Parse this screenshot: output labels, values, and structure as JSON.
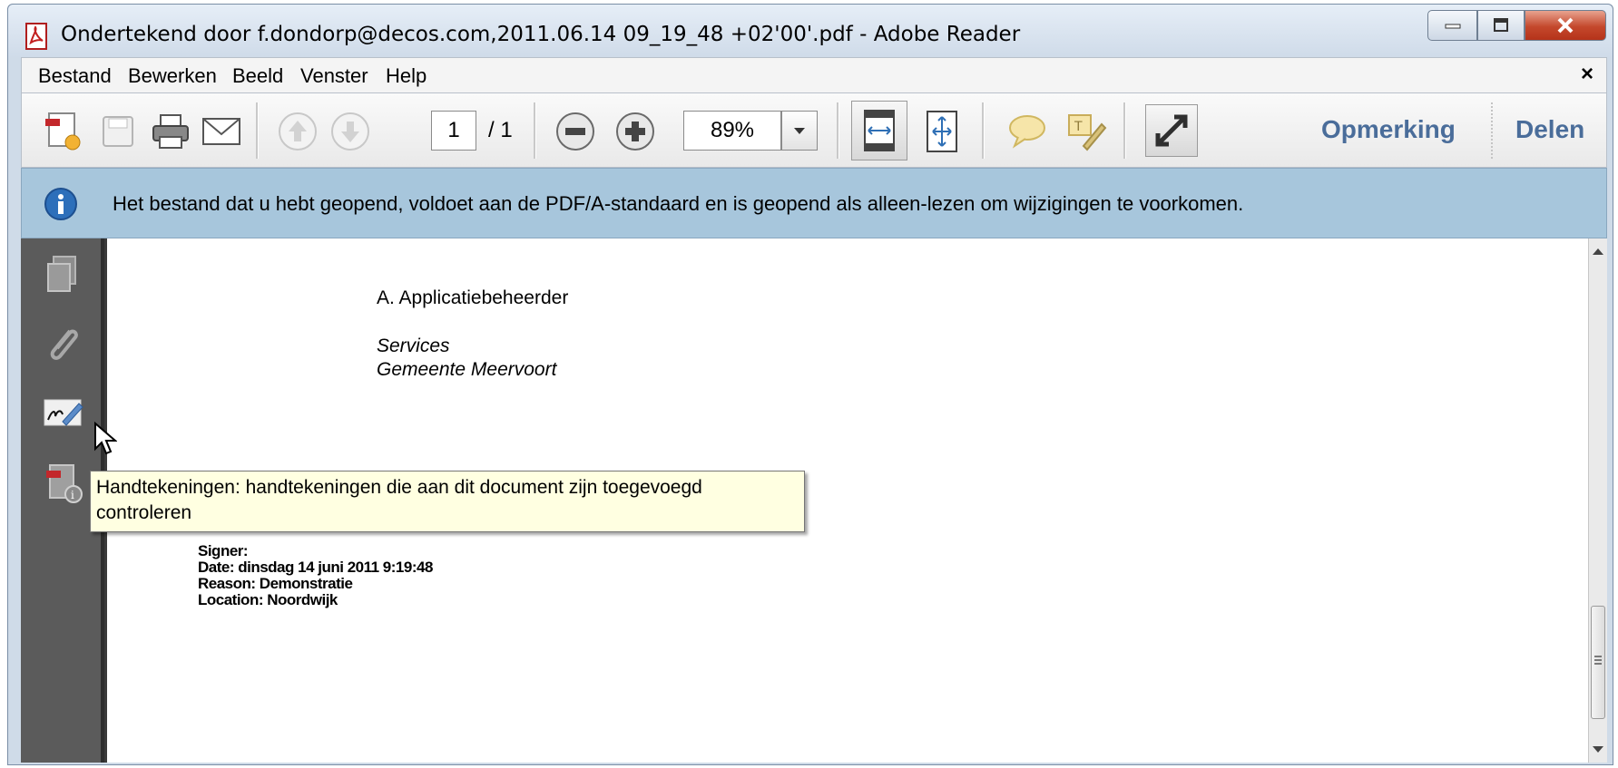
{
  "window": {
    "title": "Ondertekend door f.dondorp@decos.com,2011.06.14 09_19_48 +02'00'.pdf - Adobe Reader"
  },
  "menubar": {
    "items": [
      "Bestand",
      "Bewerken",
      "Beeld",
      "Venster",
      "Help"
    ],
    "close_label": "×"
  },
  "toolbar": {
    "page_current": "1",
    "page_total": "/ 1",
    "zoom": "89%",
    "comment_label": "Opmerking",
    "share_label": "Delen"
  },
  "infobar": {
    "message": "Het bestand dat u hebt geopend, voldoet aan de PDF/A-standaard en is geopend als alleen-lezen om wijzigingen te voorkomen."
  },
  "document": {
    "name_line": "A. Applicatiebeheerder",
    "department": "Services",
    "organisation": "Gemeente Meervoort",
    "signature": {
      "signer": "Signer:",
      "date": "Date: dinsdag 14 juni 2011 9:19:48",
      "reason": "Reason: Demonstratie",
      "location": "Location: Noordwijk"
    }
  },
  "tooltip": {
    "text_line1": "Handtekeningen: handtekeningen die aan dit document zijn toegevoegd",
    "text_line2": "controleren"
  },
  "colors": {
    "title_bg": "#cfdbe9",
    "infobar_bg": "#a7c6dc",
    "nav_bg": "#5b5b5b",
    "tooltip_bg": "#ffffe1",
    "accent_link": "#4a6d9a",
    "close_button": "#c4482c"
  },
  "icons": [
    "pdf-app-icon",
    "create-pdf-icon",
    "save-icon",
    "print-icon",
    "email-icon",
    "prev-page-icon",
    "next-page-icon",
    "zoom-out-icon",
    "zoom-in-icon",
    "fit-page-icon",
    "fit-width-icon",
    "comment-icon",
    "highlight-icon",
    "fullscreen-icon",
    "info-icon",
    "pages-icon",
    "attachments-icon",
    "signatures-icon",
    "document-info-icon"
  ]
}
